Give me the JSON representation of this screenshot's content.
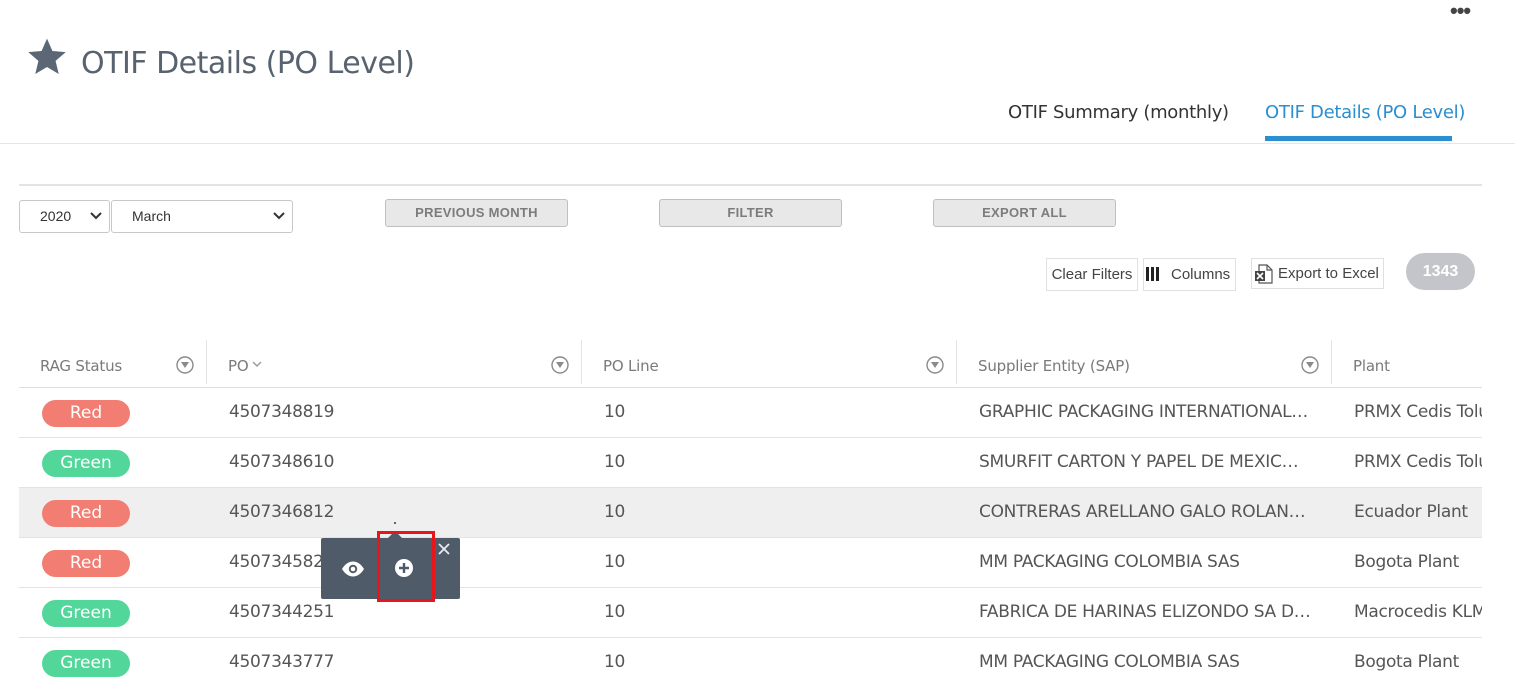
{
  "header": {
    "title": "OTIF Details (PO Level)",
    "more_menu": "•••",
    "tabs": [
      {
        "label": "OTIF Summary (monthly)",
        "active": false
      },
      {
        "label": "OTIF Details (PO Level)",
        "active": true
      }
    ]
  },
  "filters": {
    "year": "2020",
    "month": "March",
    "previous_month_label": "PREVIOUS MONTH",
    "filter_label": "FILTER",
    "export_all_label": "EXPORT ALL"
  },
  "toolbar": {
    "clear_filters": "Clear Filters",
    "columns": "Columns",
    "export_excel": "Export to Excel",
    "count": "1343"
  },
  "table": {
    "columns": [
      "RAG Status",
      "PO",
      "PO Line",
      "Supplier Entity (SAP)",
      "Plant"
    ],
    "rows": [
      {
        "rag": "Red",
        "po": "4507348819",
        "line": "10",
        "supplier": "GRAPHIC PACKAGING INTERNATIONAL DE MEXICO",
        "plant": "PRMX Cedis Toluca"
      },
      {
        "rag": "Green",
        "po": "4507348610",
        "line": "10",
        "supplier": "SMURFIT CARTON Y PAPEL DE MEXICO SA DE CV",
        "plant": "PRMX Cedis Toluca"
      },
      {
        "rag": "Red",
        "po": "4507346812",
        "line": "10",
        "supplier": "CONTRERAS ARELLANO GALO ROLANDO",
        "plant": "Ecuador Plant"
      },
      {
        "rag": "Red",
        "po": "4507345828",
        "line": "10",
        "supplier": "MM PACKAGING COLOMBIA SAS",
        "plant": "Bogota Plant"
      },
      {
        "rag": "Green",
        "po": "4507344251",
        "line": "10",
        "supplier": "FABRICA DE HARINAS ELIZONDO SA DE CV",
        "plant": "Macrocedis KLM"
      },
      {
        "rag": "Green",
        "po": "4507343777",
        "line": "10",
        "supplier": "MM PACKAGING COLOMBIA SAS",
        "plant": "Bogota Plant"
      }
    ]
  },
  "colors": {
    "accent": "#2a8ed0",
    "red_status": "#f27d72",
    "green_status": "#52d69a",
    "popup_bg": "#4f5b69",
    "highlight": "#e8161b"
  },
  "icons": [
    "star-icon",
    "chevron-down-icon",
    "filter-icon",
    "sort-icon",
    "columns-icon",
    "excel-icon",
    "eye-icon",
    "plus-circle-icon",
    "close-icon"
  ]
}
